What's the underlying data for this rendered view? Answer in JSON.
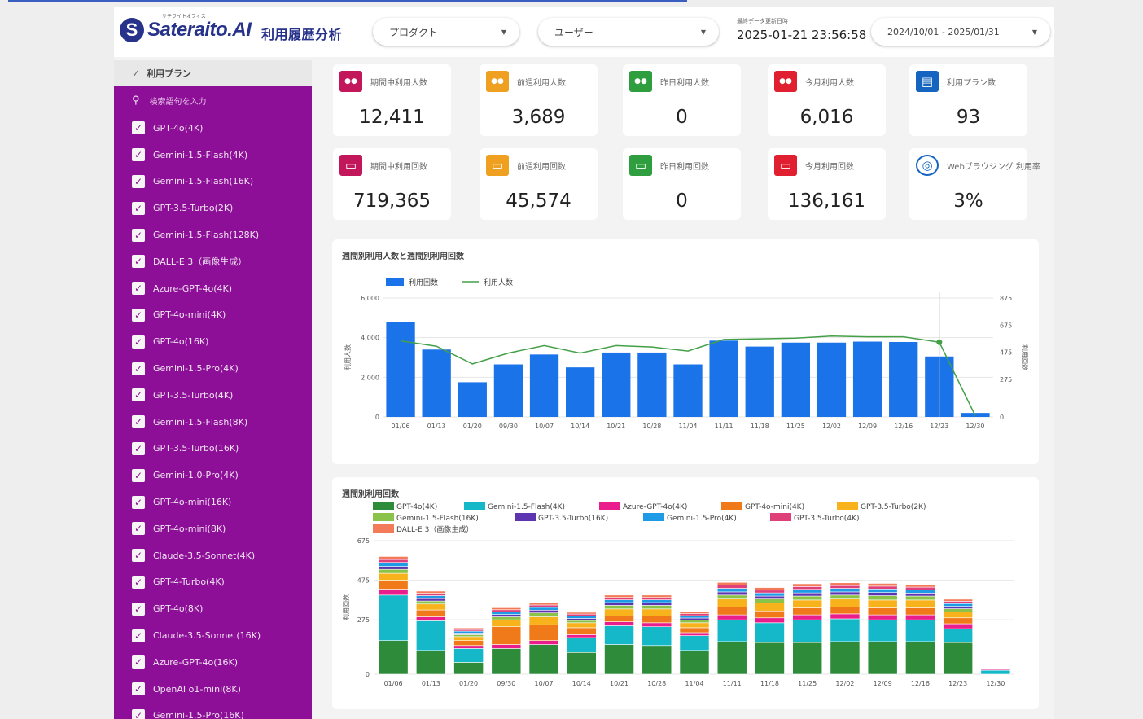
{
  "header": {
    "logo_tagline": "サテライトオフィス",
    "logo_text": "Sateraito.AI",
    "app_title": "利用履歴分析",
    "product_filter": "プロダクト",
    "user_filter": "ユーザー",
    "update_label": "最終データ更新日時",
    "update_value": "2025-01-21 23:56:58",
    "date_range": "2024/10/01 - 2025/01/31"
  },
  "sidebar": {
    "header": "利用プラン",
    "search_placeholder": "検索語句を入力",
    "items": [
      "GPT-4o(4K)",
      "Gemini-1.5-Flash(4K)",
      "Gemini-1.5-Flash(16K)",
      "GPT-3.5-Turbo(2K)",
      "Gemini-1.5-Flash(128K)",
      "DALL-E 3（画像生成）",
      "Azure-GPT-4o(4K)",
      "GPT-4o-mini(4K)",
      "GPT-4o(16K)",
      "Gemini-1.5-Pro(4K)",
      "GPT-3.5-Turbo(4K)",
      "Gemini-1.5-Flash(8K)",
      "GPT-3.5-Turbo(16K)",
      "Gemini-1.0-Pro(4K)",
      "GPT-4o-mini(16K)",
      "GPT-4o-mini(8K)",
      "Claude-3.5-Sonnet(4K)",
      "GPT-4-Turbo(4K)",
      "GPT-4o(8K)",
      "Claude-3.5-Sonnet(16K)",
      "Azure-GPT-4o(16K)",
      "OpenAI o1-mini(8K)",
      "Gemini-1.5-Pro(16K)"
    ]
  },
  "kpis": [
    {
      "label": "期間中利用人数",
      "value": "12,411",
      "icon": "people-icon",
      "color": "#c2185b"
    },
    {
      "label": "前週利用人数",
      "value": "3,689",
      "icon": "people-icon",
      "color": "#f0a020"
    },
    {
      "label": "昨日利用人数",
      "value": "0",
      "icon": "people-icon",
      "color": "#2e9e3e"
    },
    {
      "label": "今月利用人数",
      "value": "6,016",
      "icon": "people-icon",
      "color": "#e02030"
    },
    {
      "label": "利用プラン数",
      "value": "93",
      "icon": "clipboard-icon",
      "color": "#1565c0"
    },
    {
      "label": "期間中利用回数",
      "value": "719,365",
      "icon": "monitor-icon",
      "color": "#c2185b"
    },
    {
      "label": "前週利用回数",
      "value": "45,574",
      "icon": "monitor-icon",
      "color": "#f0a020"
    },
    {
      "label": "昨日利用回数",
      "value": "0",
      "icon": "monitor-icon",
      "color": "#2e9e3e"
    },
    {
      "label": "今月利用回数",
      "value": "136,161",
      "icon": "monitor-icon",
      "color": "#e02030"
    },
    {
      "label": "Webブラウジング 利用率",
      "value": "3%",
      "icon": "globe-icon",
      "color": "#1565c0"
    }
  ],
  "chart_data": [
    {
      "type": "bar",
      "title": "週間別利用人数と週間別利用回数",
      "categories": [
        "01/06",
        "01/13",
        "01/20",
        "09/30",
        "10/07",
        "10/14",
        "10/21",
        "10/28",
        "11/04",
        "11/11",
        "11/18",
        "11/25",
        "12/02",
        "12/09",
        "12/16",
        "12/23",
        "12/30"
      ],
      "legend_position": "top-left",
      "ylabel_left": "利用人数",
      "ylabel_right": "利用回数",
      "y_left_ticks": [
        "0",
        "2,000",
        "4,000",
        "6,000"
      ],
      "y_right_ticks": [
        "0",
        "275",
        "475",
        "675",
        "875"
      ],
      "ylim_left": [
        0,
        6000
      ],
      "ylim_right": [
        0,
        875
      ],
      "series": [
        {
          "name": "利用回数",
          "kind": "bar",
          "color": "#1a73e8",
          "values": [
            4800,
            3400,
            1750,
            2650,
            3150,
            2500,
            3250,
            3250,
            2650,
            3850,
            3550,
            3750,
            3750,
            3800,
            3780,
            3050,
            200
          ]
        },
        {
          "name": "利用人数",
          "kind": "line",
          "color": "#43a047",
          "values": [
            560,
            520,
            390,
            470,
            525,
            470,
            525,
            515,
            485,
            570,
            575,
            580,
            595,
            590,
            590,
            550,
            10
          ]
        }
      ]
    },
    {
      "type": "bar",
      "stacked": true,
      "title": "週間別利用回数",
      "categories": [
        "01/06",
        "01/13",
        "01/20",
        "09/30",
        "10/07",
        "10/14",
        "10/21",
        "10/28",
        "11/04",
        "11/11",
        "11/18",
        "11/25",
        "12/02",
        "12/09",
        "12/16",
        "12/23",
        "12/30"
      ],
      "ylabel": "利用回数",
      "y_ticks": [
        "0",
        "275",
        "475",
        "675"
      ],
      "ylim": [
        0,
        675
      ],
      "legend_position": "top",
      "series": [
        {
          "name": "GPT-4o(4K)",
          "color": "#2e8b3a",
          "values": [
            170,
            120,
            60,
            130,
            150,
            110,
            150,
            145,
            120,
            165,
            160,
            160,
            165,
            165,
            165,
            160,
            0
          ]
        },
        {
          "name": "Gemini-1.5-Flash(4K)",
          "color": "#14b8c8",
          "values": [
            230,
            150,
            70,
            0,
            0,
            75,
            95,
            95,
            75,
            110,
            100,
            115,
            115,
            110,
            110,
            70,
            20
          ]
        },
        {
          "name": "Azure-GPT-4o(4K)",
          "color": "#e91e8c",
          "values": [
            30,
            20,
            15,
            20,
            20,
            15,
            20,
            20,
            15,
            25,
            25,
            25,
            25,
            25,
            25,
            25,
            5
          ]
        },
        {
          "name": "GPT-4o-mini(4K)",
          "color": "#f07a1a",
          "values": [
            45,
            35,
            25,
            90,
            80,
            35,
            30,
            35,
            25,
            40,
            35,
            35,
            35,
            35,
            35,
            30,
            0
          ]
        },
        {
          "name": "GPT-3.5-Turbo(2K)",
          "color": "#f8b21c",
          "values": [
            35,
            30,
            20,
            35,
            40,
            25,
            35,
            35,
            25,
            40,
            40,
            40,
            40,
            40,
            40,
            30,
            0
          ]
        },
        {
          "name": "Gemini-1.5-Flash(16K)",
          "color": "#8bc34a",
          "values": [
            20,
            15,
            10,
            15,
            20,
            12,
            18,
            18,
            14,
            20,
            20,
            20,
            20,
            22,
            20,
            16,
            0
          ]
        },
        {
          "name": "GPT-3.5-Turbo(16K)",
          "color": "#5e35b1",
          "values": [
            15,
            12,
            8,
            12,
            14,
            10,
            14,
            14,
            10,
            16,
            15,
            16,
            16,
            16,
            15,
            12,
            0
          ]
        },
        {
          "name": "Gemini-1.5-Pro(4K)",
          "color": "#1e9be6",
          "values": [
            20,
            15,
            10,
            12,
            14,
            12,
            14,
            14,
            12,
            18,
            16,
            18,
            18,
            18,
            16,
            14,
            5
          ]
        },
        {
          "name": "GPT-3.5-Turbo(4K)",
          "color": "#e0407a",
          "values": [
            15,
            12,
            8,
            12,
            12,
            10,
            12,
            12,
            10,
            16,
            14,
            14,
            14,
            14,
            14,
            12,
            0
          ]
        },
        {
          "name": "DALL-E 3（画像生成）",
          "color": "#f47b5a",
          "values": [
            15,
            11,
            8,
            10,
            12,
            9,
            12,
            12,
            9,
            14,
            13,
            14,
            14,
            14,
            14,
            10,
            0
          ]
        }
      ]
    }
  ]
}
